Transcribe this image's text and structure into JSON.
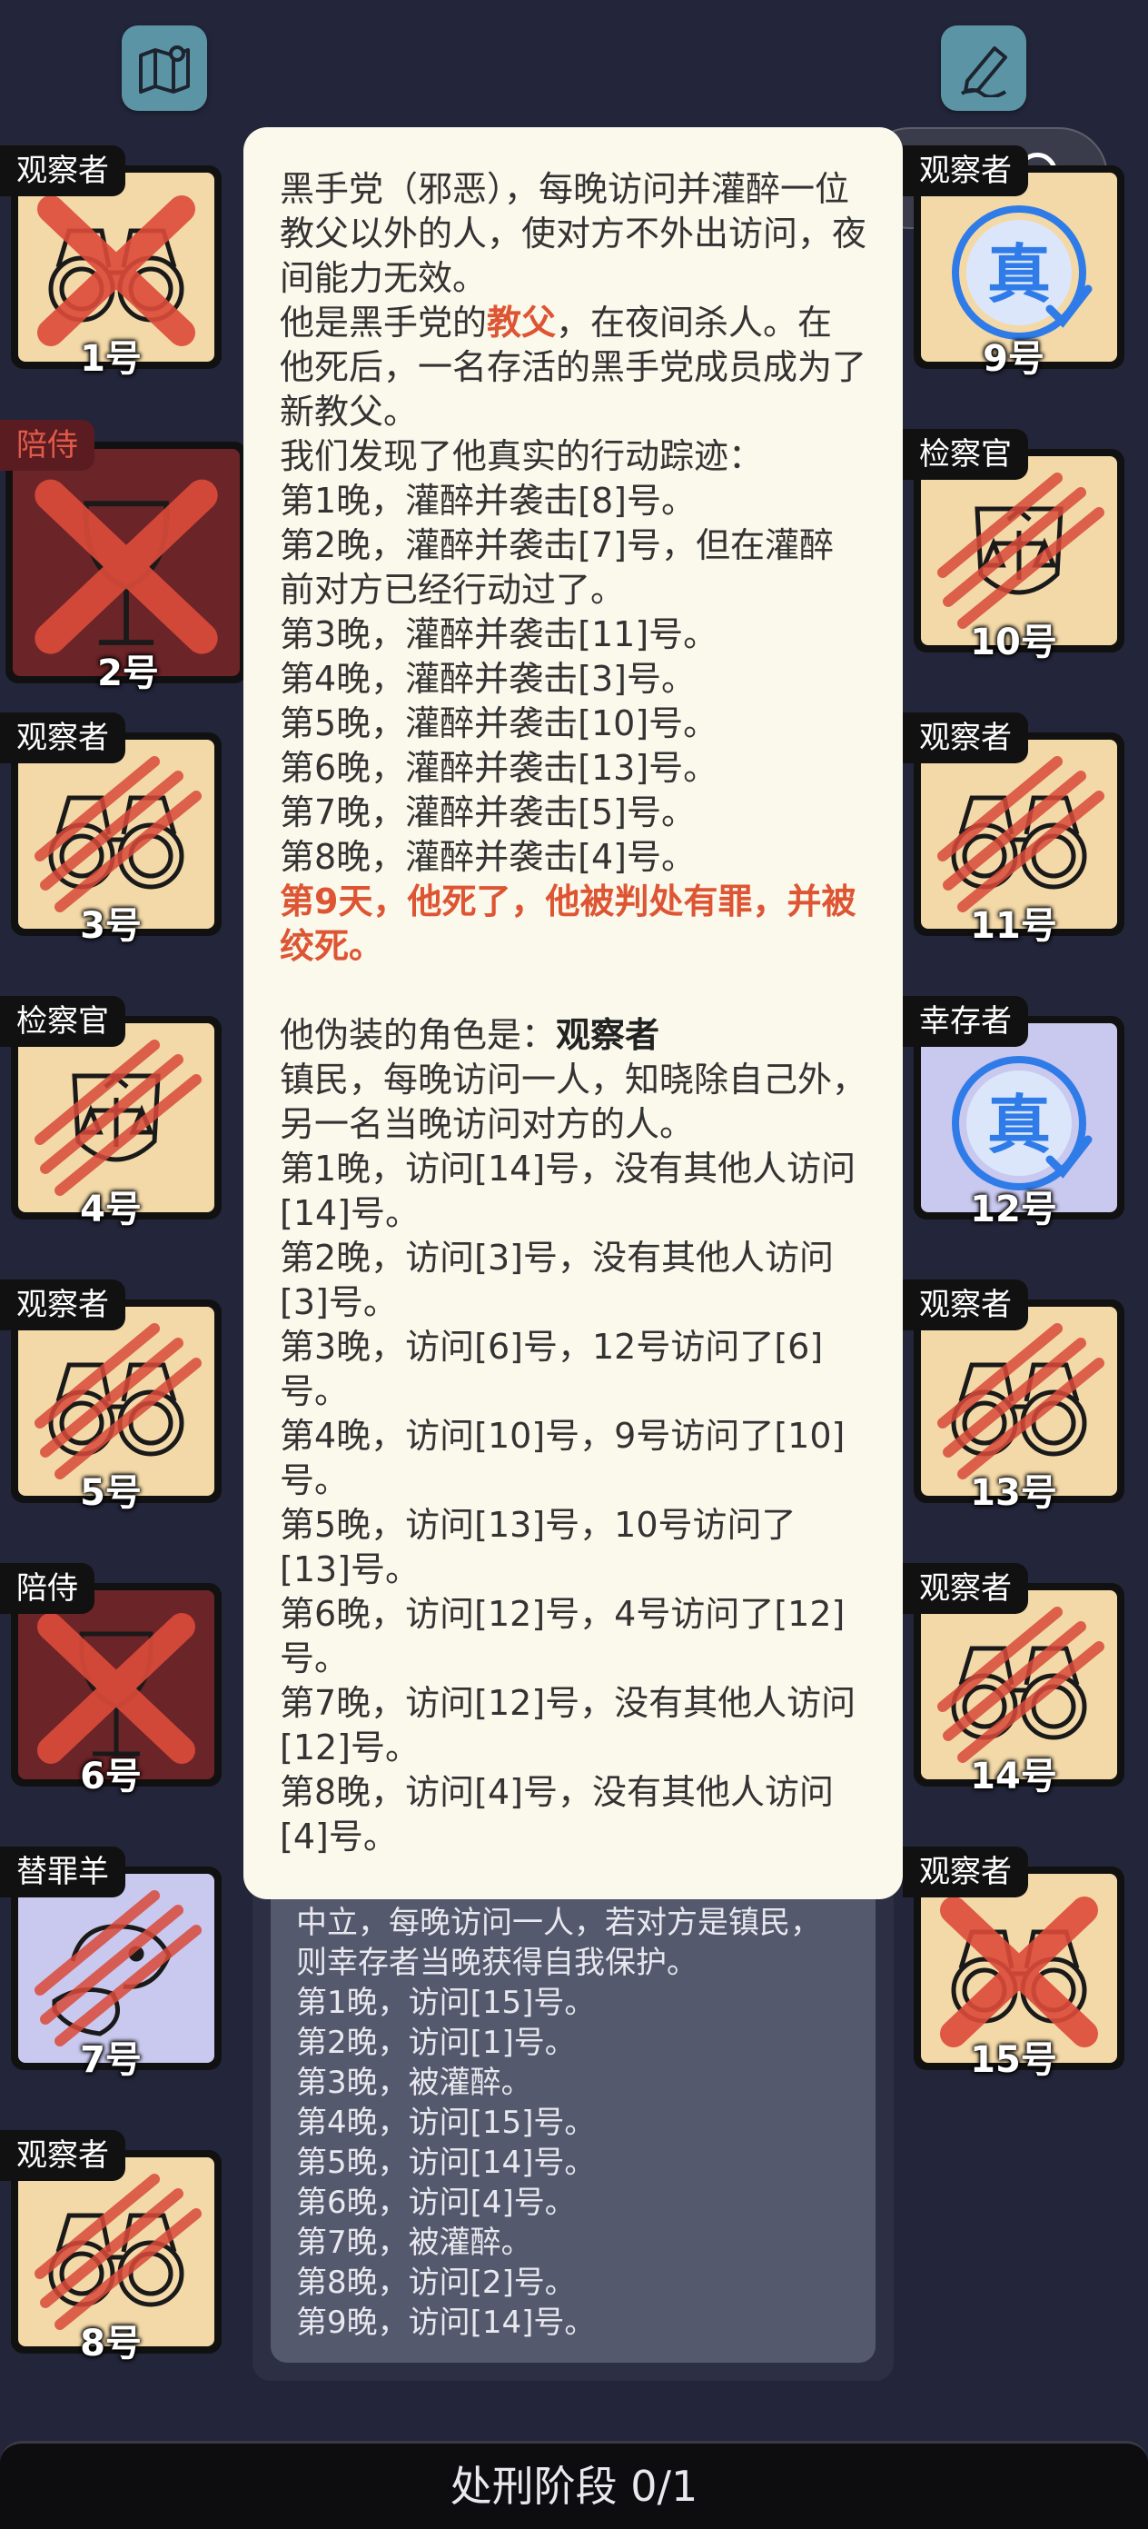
{
  "players": [
    {
      "num": "1号",
      "role": "观察者",
      "type": "binoculars",
      "state": "crossed"
    },
    {
      "num": "2号",
      "role": "陪侍",
      "type": "wine",
      "state": "crossed"
    },
    {
      "num": "3号",
      "role": "观察者",
      "type": "binoculars",
      "state": "clawed"
    },
    {
      "num": "4号",
      "role": "检察官",
      "type": "scales",
      "state": "clawed"
    },
    {
      "num": "5号",
      "role": "观察者",
      "type": "binoculars",
      "state": "clawed"
    },
    {
      "num": "6号",
      "role": "陪侍",
      "type": "wine",
      "state": "crossed"
    },
    {
      "num": "7号",
      "role": "替罪羊",
      "type": "goat",
      "state": "clawed"
    },
    {
      "num": "8号",
      "role": "观察者",
      "type": "binoculars",
      "state": "clawed"
    },
    {
      "num": "9号",
      "role": "观察者",
      "type": "truth",
      "state": "alive"
    },
    {
      "num": "10号",
      "role": "检察官",
      "type": "scales",
      "state": "clawed"
    },
    {
      "num": "11号",
      "role": "观察者",
      "type": "binoculars",
      "state": "clawed"
    },
    {
      "num": "12号",
      "role": "幸存者",
      "type": "truth",
      "state": "alive"
    },
    {
      "num": "13号",
      "role": "观察者",
      "type": "binoculars",
      "state": "clawed"
    },
    {
      "num": "14号",
      "role": "观察者",
      "type": "binoculars",
      "state": "clawed"
    },
    {
      "num": "15号",
      "role": "观察者",
      "type": "binoculars",
      "state": "crossed"
    }
  ],
  "popup": {
    "role_desc_1": "黑手党（邪恶），每晚访问并灌醉一位教父以外的人，使对方不外出访问，夜间能力无效。",
    "intro_pre": "他是黑手党的",
    "intro_role": "教父",
    "intro_post": "，在夜间杀人。在他死后，一名存活的黑手党成员成为了新教父。",
    "trace_title": "我们发现了他真实的行动踪迹：",
    "real_actions": [
      "第1晚，灌醉并袭击[8]号。",
      "第2晚，灌醉并袭击[7]号，但在灌醉前对方已经行动过了。",
      "第3晚，灌醉并袭击[11]号。",
      "第4晚，灌醉并袭击[3]号。",
      "第5晚，灌醉并袭击[10]号。",
      "第6晚，灌醉并袭击[13]号。",
      "第7晚，灌醉并袭击[5]号。",
      "第8晚，灌醉并袭击[4]号。"
    ],
    "death_note": "第9天，他死了，他被判处有罪，并被绞死。",
    "disguise_label": "他伪装的角色是：",
    "disguise_role": "观察者",
    "disguise_desc": "镇民，每晚访问一人，知晓除自己外，另一名当晚访问对方的人。",
    "fake_actions": [
      "第1晚，访问[14]号，没有其他人访问[14]号。",
      "第2晚，访问[3]号，没有其他人访问[3]号。",
      "第3晚，访问[6]号，12号访问了[6]号。",
      "第4晚，访问[10]号，9号访问了[10]号。",
      "第5晚，访问[13]号，10号访问了[13]号。",
      "第6晚，访问[12]号，4号访问了[12]号。",
      "第7晚，访问[12]号，没有其他人访问[12]号。",
      "第8晚，访问[4]号，没有其他人访问[4]号。"
    ]
  },
  "panel": {
    "desc": "中立，每晚访问一人，若对方是镇民，则幸存者当晚获得自我保护。",
    "actions": [
      "第1晚，访问[15]号。",
      "第2晚，访问[1]号。",
      "第3晚，被灌醉。",
      "第4晚，访问[15]号。",
      "第5晚，访问[14]号。",
      "第6晚，访问[4]号。",
      "第7晚，被灌醉。",
      "第8晚，访问[2]号。",
      "第9晚，访问[14]号。"
    ]
  },
  "bottom": {
    "label": "处刑阶段 0/1"
  },
  "icons": {
    "top_left": "map-icon",
    "top_right": "pen-edit-icon",
    "capsule": "mini-program-menu"
  },
  "colors": {
    "bg": "#23253a",
    "card": "#f3d9a8",
    "dead_card": "#6b2428",
    "accent_red": "#dd5533",
    "truth_blue": "#2f7be8"
  }
}
